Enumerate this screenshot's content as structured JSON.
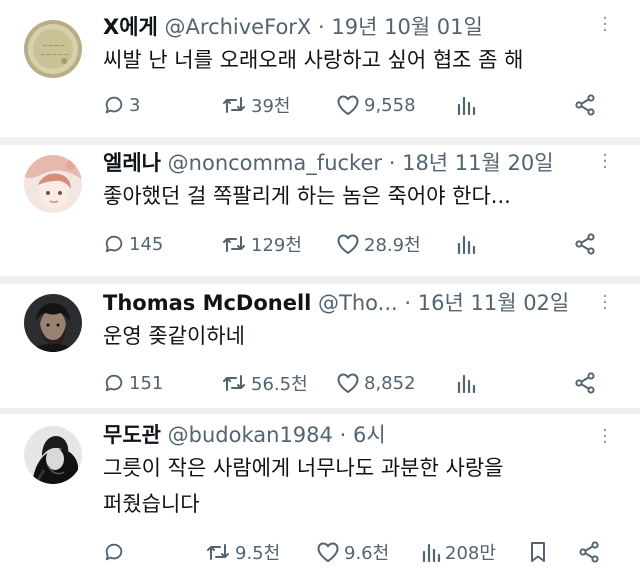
{
  "tweets": [
    {
      "name": "X에게",
      "handle": "@ArchiveForX",
      "date": "19년 10월 01일",
      "text": "씨발 난 너를 오래오래 사랑하고 싶어 협조 좀 해",
      "replies": "3",
      "retweets": "39천",
      "likes": "9,558",
      "views": ""
    },
    {
      "name": "엘레나",
      "handle": "@noncomma_fucker",
      "date": "18년 11월 20일",
      "text": "좋아했던 걸 쪽팔리게 하는 놈은 죽어야 한다...",
      "replies": "145",
      "retweets": "129천",
      "likes": "28.9천",
      "views": ""
    },
    {
      "name": "Thomas McDonell",
      "handle": "@Tho...",
      "date": "16년 11월 02일",
      "text": "운영 좆같이하네",
      "replies": "151",
      "retweets": "56.5천",
      "likes": "8,852",
      "views": ""
    },
    {
      "name": "무도관",
      "handle": "@budokan1984",
      "date": "6시",
      "text_line1": "그릇이 작은 사람에게 너무나도 과분한 사랑을",
      "text_line2": "퍼줬습니다",
      "replies": "",
      "retweets": "9.5천",
      "likes": "9.6천",
      "views": "208만"
    }
  ],
  "colors": {
    "text": "#0f1419",
    "secondary": "#536471",
    "separator": "#eef0f1"
  },
  "icons": [
    "reply-icon",
    "retweet-icon",
    "like-icon",
    "views-icon",
    "share-icon",
    "bookmark-icon",
    "more-icon"
  ]
}
